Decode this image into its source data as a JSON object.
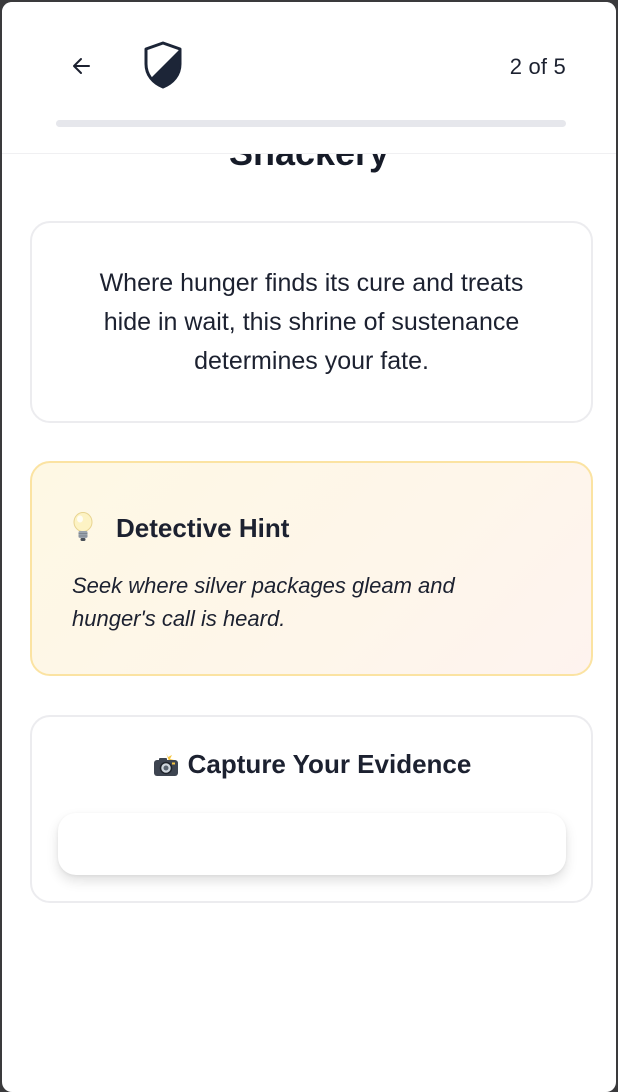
{
  "header": {
    "progress_text": "2 of 5",
    "progress_fraction": 0.4
  },
  "location": {
    "title": "Snackery",
    "riddle": "Where hunger finds its cure and treats hide in wait, this shrine of sustenance determines your fate."
  },
  "hint": {
    "icon": "lightbulb-icon",
    "title": "Detective Hint",
    "text": "Seek where silver packages gleam and hunger's call is heard."
  },
  "evidence": {
    "icon": "camera-flash-icon",
    "title": "Capture Your Evidence"
  },
  "colors": {
    "text": "#1c2130",
    "hint_border": "#fbe3a2",
    "hint_background": "#fef8e4",
    "progress_track": "#e6e7ec"
  }
}
